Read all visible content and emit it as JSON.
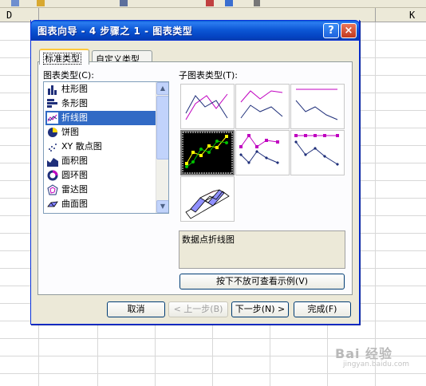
{
  "background": {
    "columns": [
      {
        "label": "D"
      },
      {
        "label": "K"
      }
    ]
  },
  "dialog": {
    "title": "图表向导 - 4 步骤之 1 - 图表类型",
    "help_label": "?",
    "close_label": "×",
    "tabs": [
      {
        "label": "标准类型",
        "active": true
      },
      {
        "label": "自定义类型",
        "active": false
      }
    ],
    "chart_type_label": "图表类型(C):",
    "subtype_label": "子图表类型(T):",
    "chart_types": [
      {
        "label": "柱形图",
        "icon": "column-chart-icon"
      },
      {
        "label": "条形图",
        "icon": "bar-chart-icon"
      },
      {
        "label": "折线图",
        "icon": "line-chart-icon",
        "selected": true
      },
      {
        "label": "饼图",
        "icon": "pie-chart-icon"
      },
      {
        "label": "XY 散点图",
        "icon": "scatter-chart-icon"
      },
      {
        "label": "面积图",
        "icon": "area-chart-icon"
      },
      {
        "label": "圆环图",
        "icon": "doughnut-chart-icon"
      },
      {
        "label": "雷达图",
        "icon": "radar-chart-icon"
      },
      {
        "label": "曲面图",
        "icon": "surface-chart-icon"
      }
    ],
    "description": "数据点折线图",
    "preview_button": "按下不放可查看示例(V)",
    "buttons": {
      "cancel": "取消",
      "back": "< 上一步(B)",
      "next": "下一步(N) >",
      "finish": "完成(F)"
    }
  },
  "colors": {
    "titlebar": "#0b55d4",
    "selection": "#316ac5",
    "dialog_bg": "#ece9d8"
  }
}
